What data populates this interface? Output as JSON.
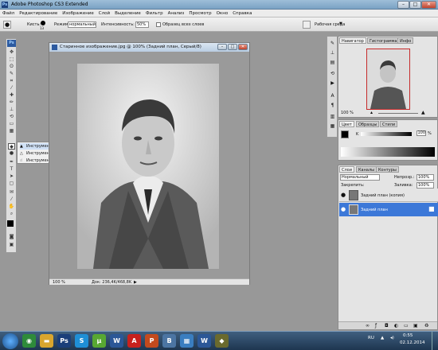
{
  "app": {
    "title": "Adobe Photoshop CS3 Extended",
    "logo": "Ps"
  },
  "menu": [
    "Файл",
    "Редактирование",
    "Изображение",
    "Слой",
    "Выделение",
    "Фильтр",
    "Анализ",
    "Просмотр",
    "Окно",
    "Справка"
  ],
  "options_bar": {
    "brush_label": "Кисть:",
    "brush_size": "13",
    "mode_label": "Режим:",
    "mode_value": "нормальный",
    "strength_label": "Интенсивность:",
    "strength_value": "50%",
    "sample_all_label": "Образец всех слоев",
    "workspace_label": "Рабочая среда"
  },
  "document": {
    "title": "Старинное изображение.jpg @ 100% (Задний план, Серый/8)",
    "zoom": "100 %",
    "doc_info": "Док: 236,4K/468,8K"
  },
  "tool_flyout": {
    "items": [
      {
        "label": "Инструмент \"Размытие\"",
        "key": "R"
      },
      {
        "label": "Инструмент \"Резкость\"",
        "key": "R"
      },
      {
        "label": "Инструмент \"Палец\"",
        "key": "R"
      }
    ]
  },
  "navigator_panel": {
    "tabs": [
      "Навигатор",
      "Гистограмма",
      "Инфо"
    ],
    "zoom": "100 %"
  },
  "color_panel": {
    "tabs": [
      "Цвет",
      "Образцы",
      "Стили"
    ],
    "k_label": "K",
    "k_value": "100",
    "k_unit": "%"
  },
  "layers_panel": {
    "tabs": [
      "Слои",
      "Каналы",
      "Контуры"
    ],
    "blend_mode": "Нормальный",
    "opacity_label": "Непрозр.:",
    "opacity_value": "100%",
    "lock_label": "Закрепить:",
    "fill_label": "Заливка:",
    "fill_value": "100%",
    "layers": [
      {
        "name": "Задний план (копия)",
        "selected": false
      },
      {
        "name": "Задний план",
        "selected": true
      }
    ]
  },
  "taskbar": {
    "lang": "RU",
    "time": "0:55",
    "date": "02.12.2014",
    "apps": [
      {
        "icon": "chrome-icon",
        "glyph": "◉",
        "color": "#2e8b3a"
      },
      {
        "icon": "folder-icon",
        "glyph": "▬",
        "color": "#d9a62e"
      },
      {
        "icon": "photoshop-icon",
        "glyph": "Ps",
        "color": "#1b3f7a"
      },
      {
        "icon": "skype-icon",
        "glyph": "S",
        "color": "#1f8fd6"
      },
      {
        "icon": "utorrent-icon",
        "glyph": "µ",
        "color": "#58a832"
      },
      {
        "icon": "word-icon",
        "glyph": "W",
        "color": "#2b5797"
      },
      {
        "icon": "pdf-icon",
        "glyph": "A",
        "color": "#c8211d"
      },
      {
        "icon": "ppt-icon",
        "glyph": "P",
        "color": "#c34a1e"
      },
      {
        "icon": "vk-icon",
        "glyph": "В",
        "color": "#4c75a3"
      },
      {
        "icon": "explorer-icon",
        "glyph": "▦",
        "color": "#3a7ec0"
      },
      {
        "icon": "word2-icon",
        "glyph": "W",
        "color": "#2b5797"
      },
      {
        "icon": "winamp-icon",
        "glyph": "◆",
        "color": "#6a6a2e"
      }
    ]
  }
}
